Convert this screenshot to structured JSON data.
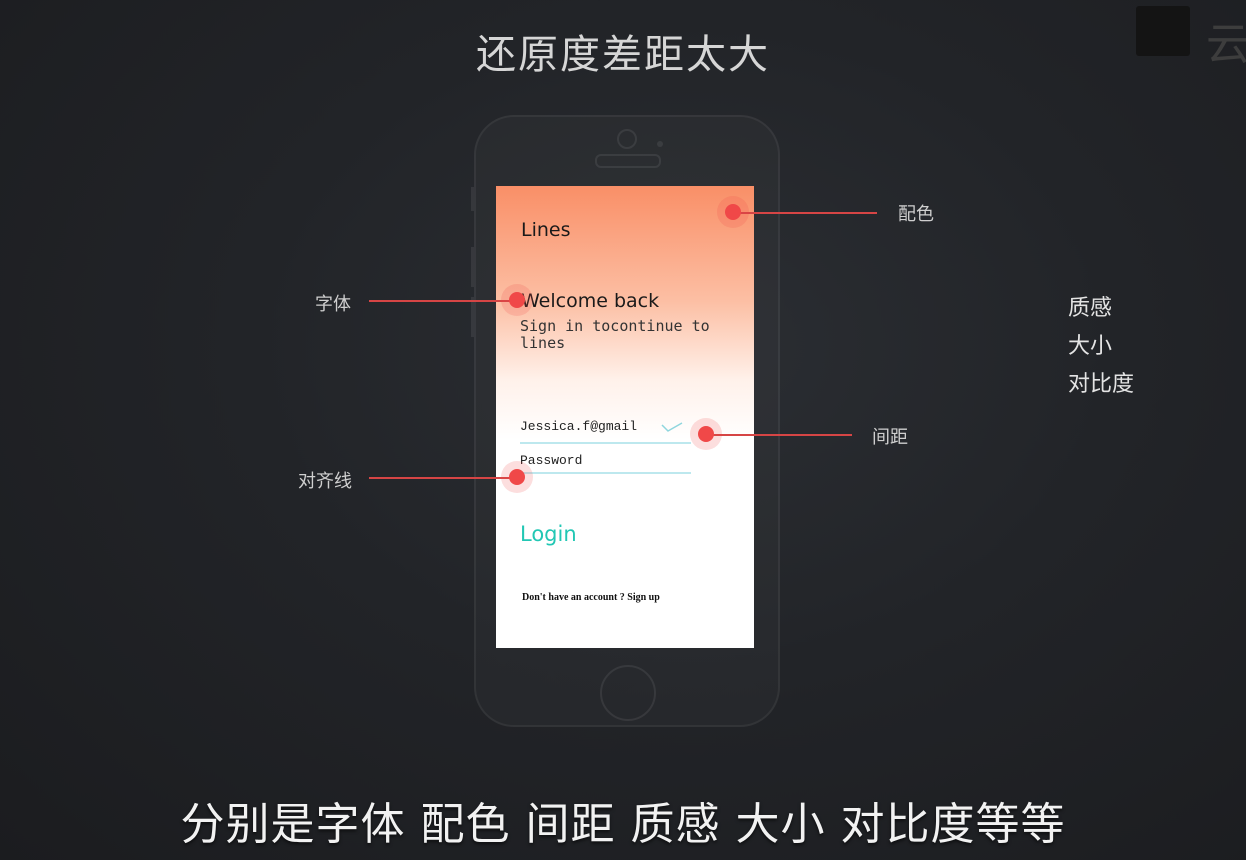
{
  "slide": {
    "title": "还原度差距太大",
    "caption": "分别是字体  配色  间距  质感  大小  对比度等等"
  },
  "logo": {
    "char": "云"
  },
  "app": {
    "name": "Lines",
    "welcome": "Welcome back",
    "subtitle": "Sign in tocontinue to lines",
    "email_value": "Jessica.f@gmail",
    "password_placeholder": "Password",
    "login_label": "Login",
    "signup_text": "Don't have an account ? Sign up",
    "accent_color": "#22c7b4",
    "gradient_top": "#f98f67"
  },
  "callouts": {
    "color": "配色",
    "font": "字体",
    "spacing": "间距",
    "alignment": "对齐线"
  },
  "side_notes": [
    "质感",
    "大小",
    "对比度"
  ]
}
